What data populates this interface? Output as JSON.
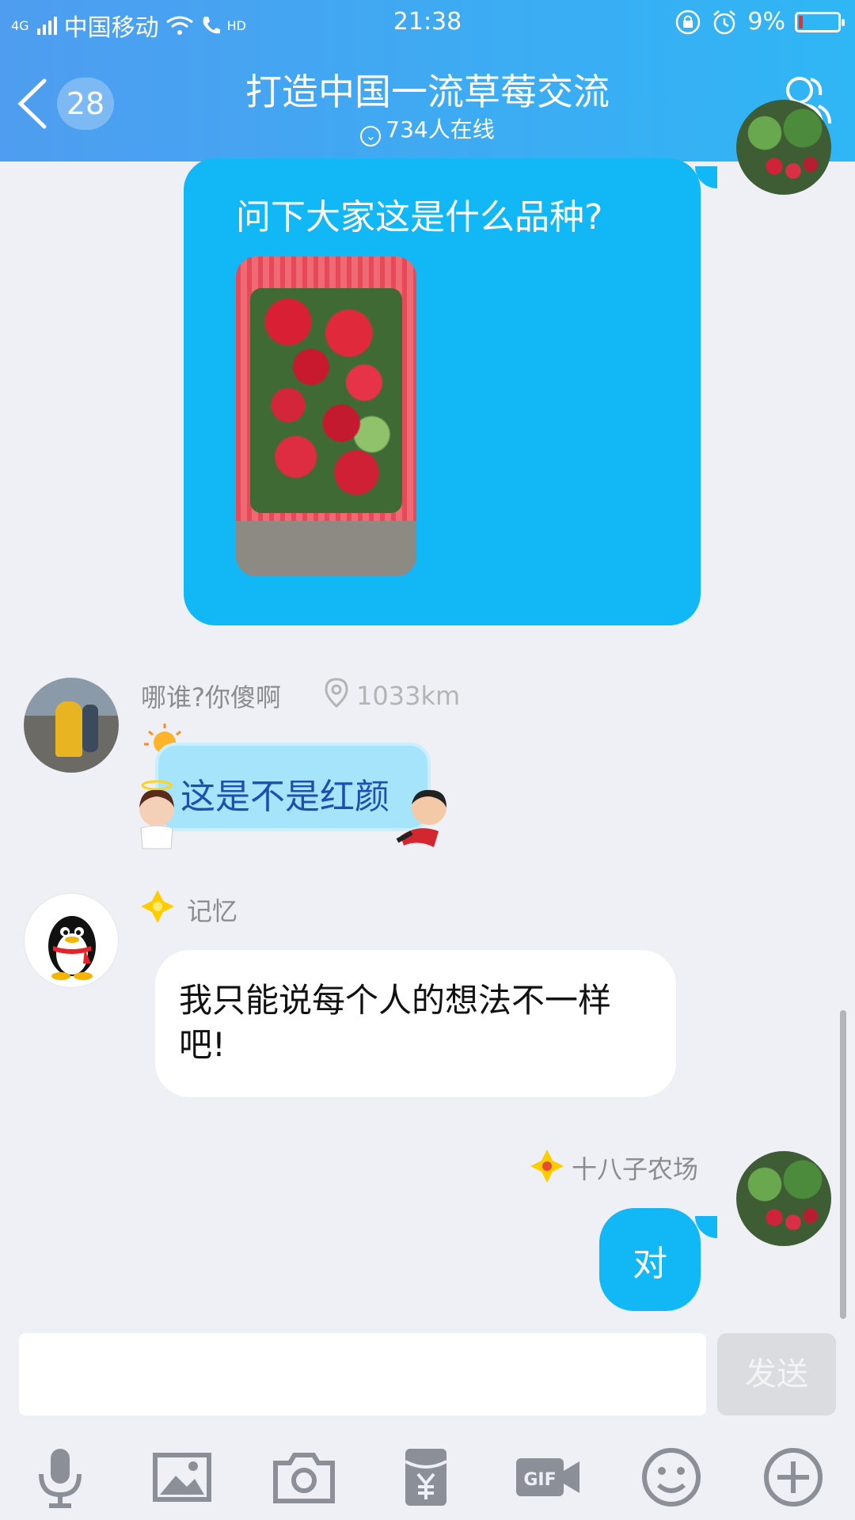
{
  "status": {
    "carrier": "中国移动",
    "network": "4G",
    "hd": "HD",
    "time": "21:38",
    "battery": "9%"
  },
  "header": {
    "unread_count": "28",
    "title": "打造中国一流草莓交流",
    "online": "734人在线"
  },
  "messages": [
    {
      "side": "right",
      "text": "问下大家这是什么品种?",
      "has_image": true
    },
    {
      "side": "left",
      "sender": "哪谁?你傻啊",
      "location": "1033km",
      "text": "这是不是红颜"
    },
    {
      "side": "left",
      "sender": "记忆",
      "text": "我只能说每个人的想法不一样吧!"
    },
    {
      "side": "right",
      "sender": "十八子农场",
      "text": "对"
    }
  ],
  "composer": {
    "send_label": "发送",
    "gif_label": "GIF"
  },
  "colors": {
    "header_start": "#4f9df0",
    "header_end": "#2fb6f5",
    "my_bubble": "#12b7f5",
    "background": "#eef0f6"
  }
}
